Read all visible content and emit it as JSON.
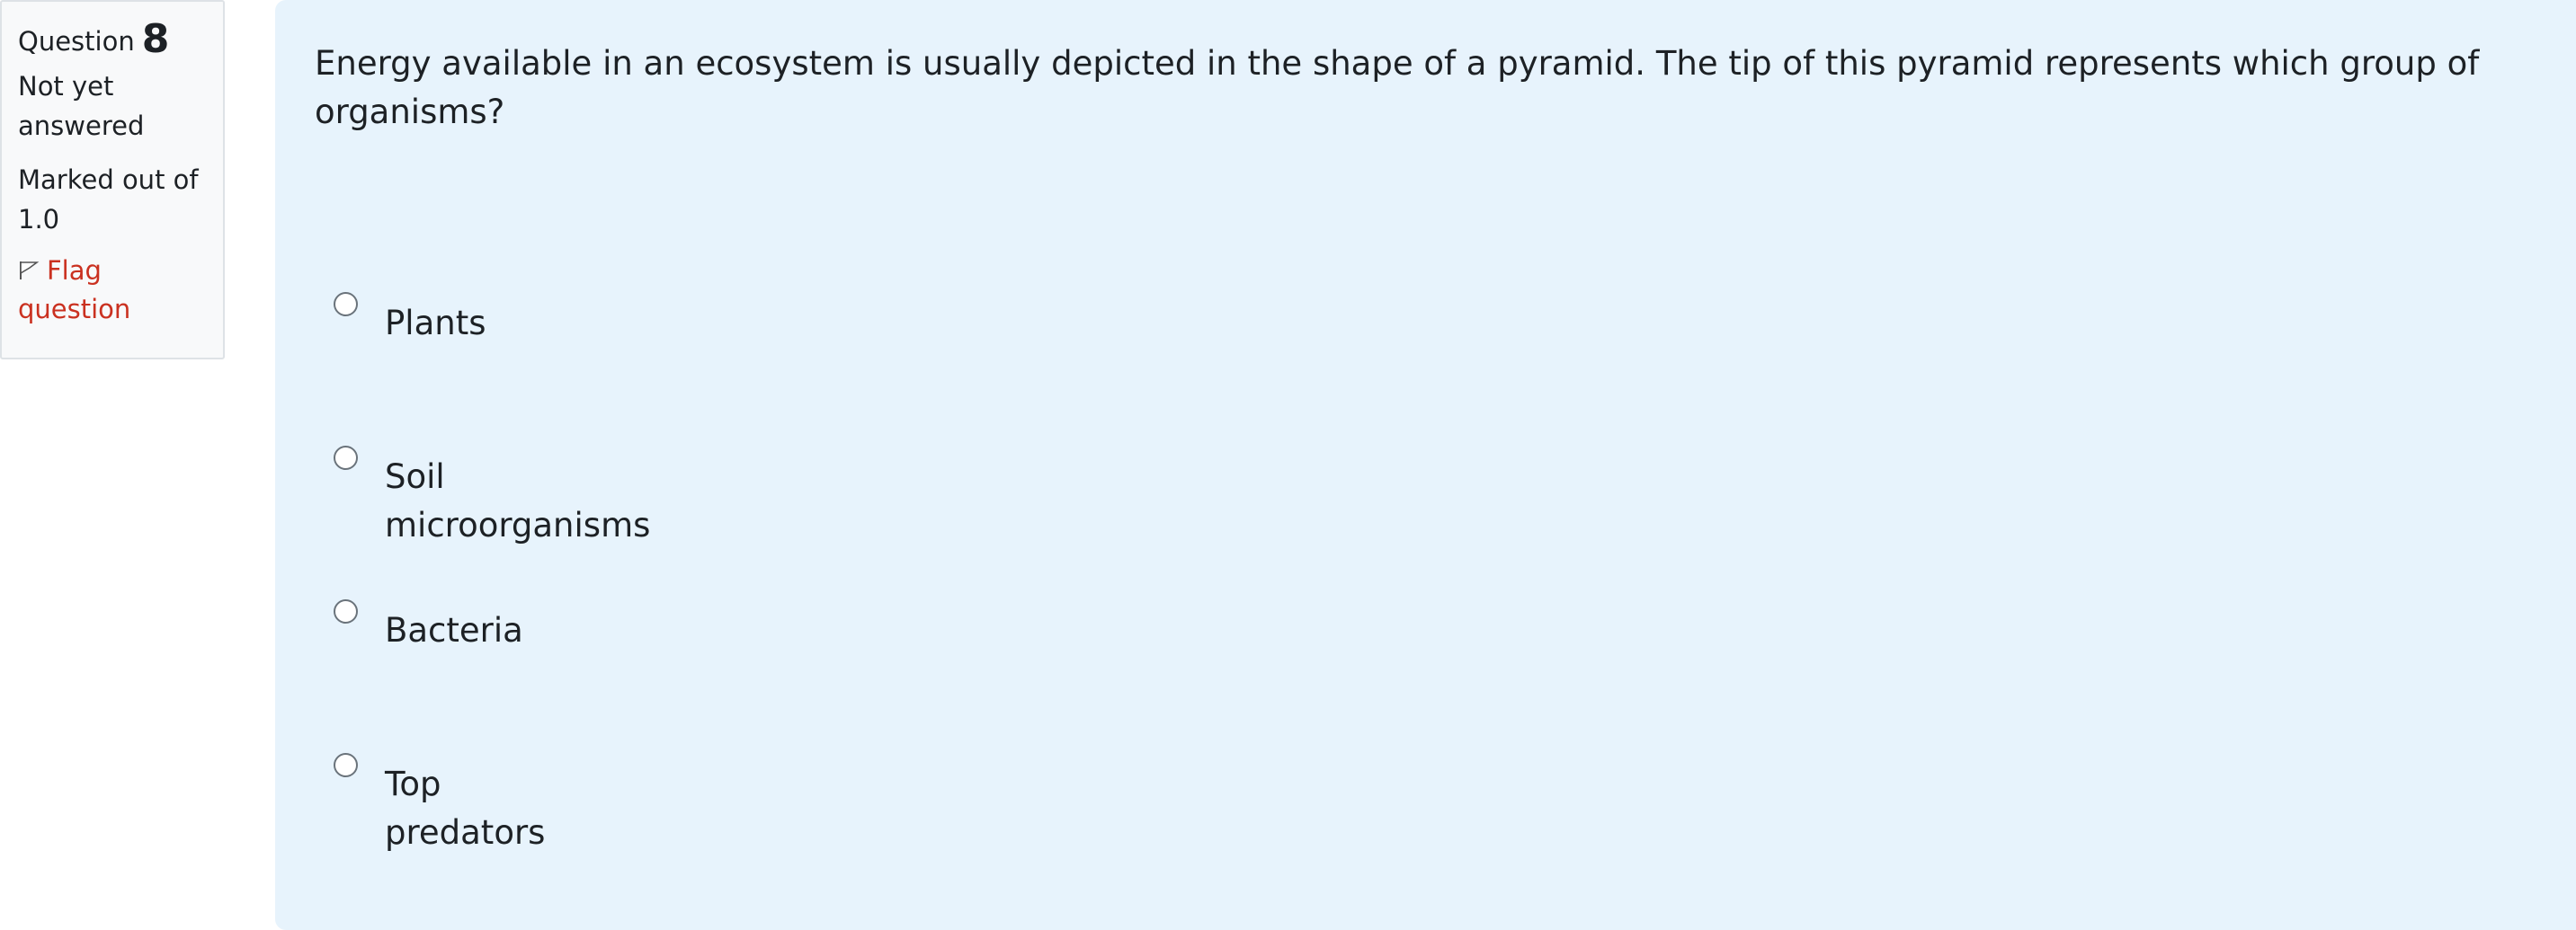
{
  "info": {
    "question_word": "Question",
    "question_number": "8",
    "state": "Not yet answered",
    "grade": "Marked out of 1.0",
    "flag_label": "Flag question"
  },
  "question": {
    "text": "Energy available in an ecosystem is usually depicted in the shape of a pyramid. The tip of this pyramid represents which group of organisms?"
  },
  "answers": [
    {
      "label": "Plants",
      "selected": false
    },
    {
      "label": "Soil microorganisms",
      "selected": false
    },
    {
      "label": "Bacteria",
      "selected": false
    },
    {
      "label": "Top predators",
      "selected": false
    }
  ],
  "colors": {
    "panel_background": "#e7f3fc",
    "info_background": "#f8f9fa",
    "flag_link": "#ca3120",
    "text": "#1d2125"
  },
  "icons": {
    "flag": "flag-icon"
  }
}
